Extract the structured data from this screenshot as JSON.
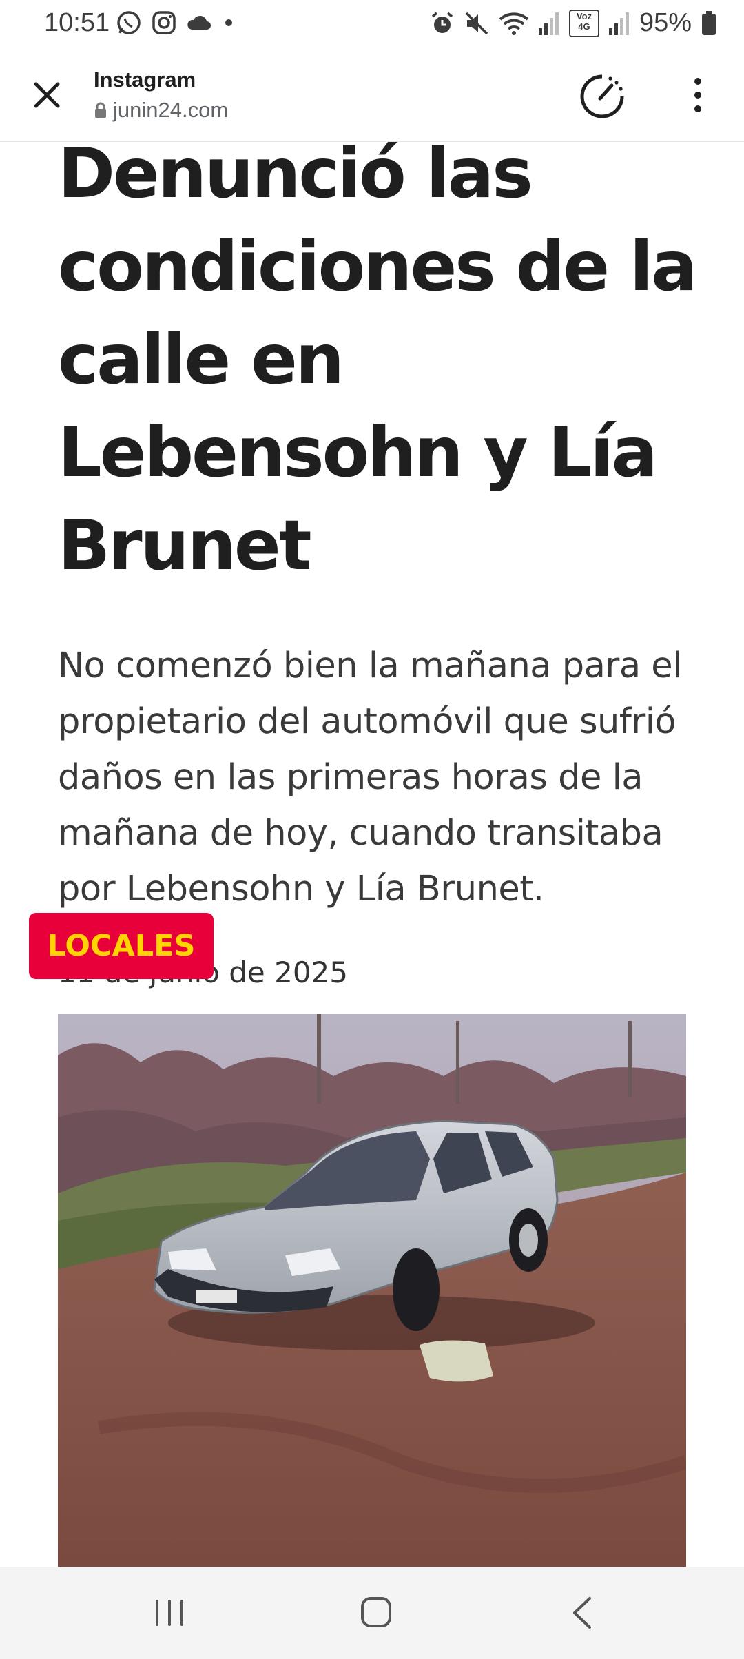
{
  "status_bar": {
    "time": "10:51",
    "battery_percent": "95%",
    "left_icons": [
      "whatsapp-icon",
      "instagram-icon",
      "cloud-icon",
      "dot-icon"
    ],
    "right_icons": [
      "alarm-icon",
      "mute-icon",
      "wifi-icon",
      "signal-icon",
      "volte-icon",
      "signal-icon",
      "battery-icon"
    ],
    "volte_label": "Voz 4G"
  },
  "browser": {
    "title": "Instagram",
    "url": "junin24.com",
    "icons": [
      "close-icon",
      "lock-icon",
      "speed-gauge-icon",
      "more-vert-icon"
    ]
  },
  "article": {
    "headline": "Denunció las condiciones de la calle en Lebensohn y Lía Brunet",
    "lead": "No comenzó bien la mañana para el propietario del automóvil que sufrió daños en las primeras horas de la mañana de hoy, cuando transitaba por Lebensohn y Lía Brunet.",
    "date": "11 de junio de 2025",
    "category_badge": "LOCALES",
    "colors": {
      "badge_bg": "#e8003a",
      "badge_text": "#ffd400"
    }
  },
  "nav_bar": {
    "icons": [
      "recent-apps-icon",
      "home-icon",
      "back-icon"
    ]
  }
}
